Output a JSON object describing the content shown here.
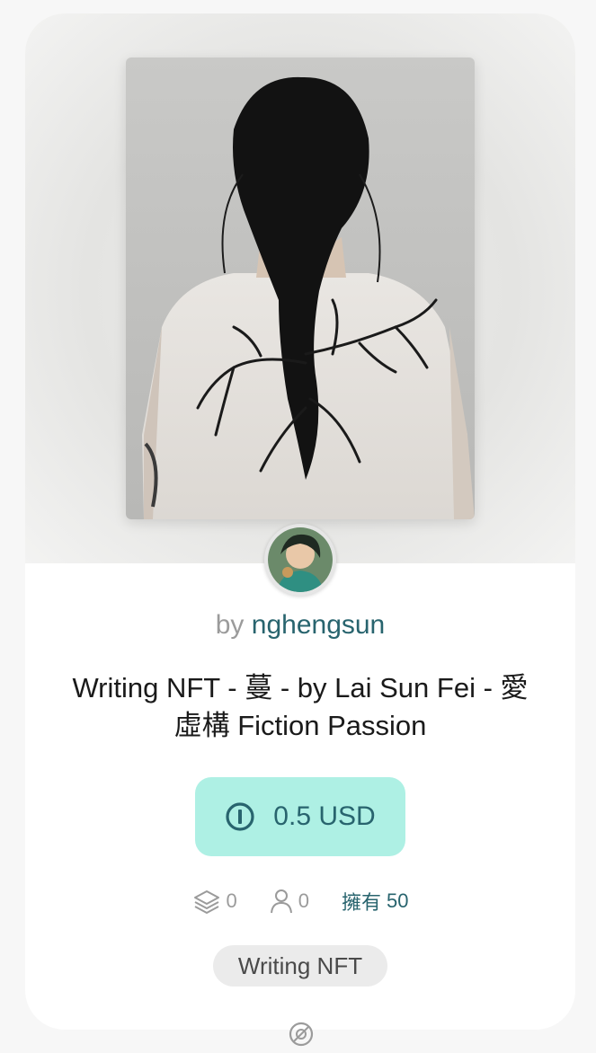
{
  "byline": {
    "prefix": "by",
    "author": "nghengsun"
  },
  "nft": {
    "title": "Writing NFT - 蔓 - by Lai Sun Fei - 愛虛構 Fiction Passion",
    "price": "0.5 USD"
  },
  "stats": {
    "collected": "0",
    "collectors": "0",
    "owned_label": "擁有",
    "owned_value": "50"
  },
  "tag": {
    "label": "Writing NFT"
  },
  "icons": {
    "price": "coin-icon",
    "collected": "layers-icon",
    "collectors": "person-icon",
    "bottom": "disc-icon"
  },
  "colors": {
    "accent": "#28646e",
    "price_bg": "#aef0e4",
    "tag_bg": "#ebebeb",
    "muted": "#9b9b9b"
  }
}
